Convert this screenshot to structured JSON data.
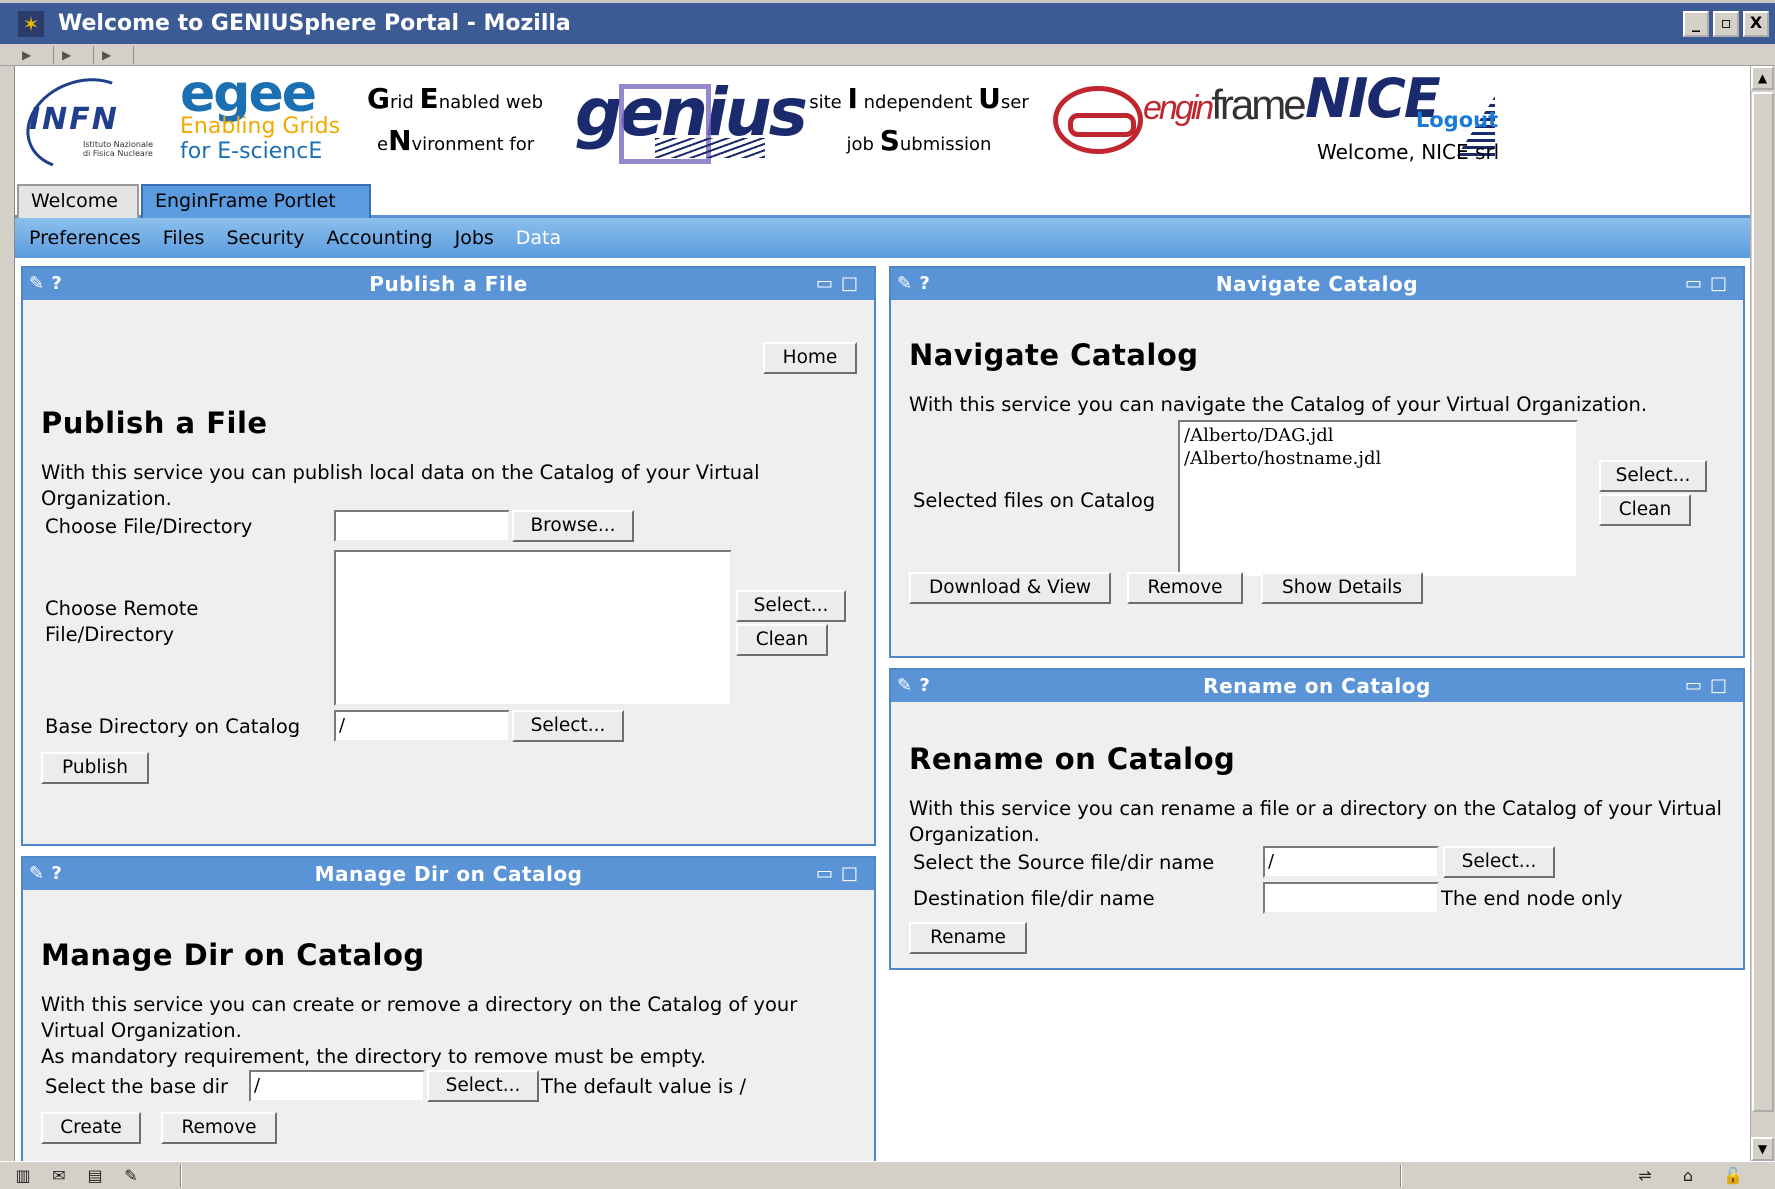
{
  "window": {
    "title": "Welcome to GENIUSphere Portal - Mozilla",
    "buttons": [
      "_",
      "▫",
      "X"
    ]
  },
  "header": {
    "infn_text": "INFN",
    "infn_small": "Istituto Nazionale di Fisica Nucleare",
    "egee_word": "egee",
    "egee_line1": "Enabling Grids",
    "egee_line2": "for E-sciencE",
    "genius_letters": [
      {
        "cap": "G",
        "rest": "rid "
      },
      {
        "cap": "E",
        "rest": "nabled web"
      },
      {
        "cap": "N",
        "rest": "vironment for"
      }
    ],
    "genius_line1_a": "G",
    "genius_line1_b": "rid",
    "genius_line1_c": "E",
    "genius_line1_d": "nabled web",
    "genius_line2_a": "e",
    "genius_line2_b": "N",
    "genius_line2_c": "vironment for",
    "genius_logo": "genius",
    "site_line1_a": "site ",
    "site_line1_b": "I",
    "site_line1_c": " ndependent ",
    "site_line1_d": "U",
    "site_line1_e": "ser",
    "site_line2_a": "job ",
    "site_line2_b": "S",
    "site_line2_c": "ubmission",
    "enginframe_a": "engin",
    "enginframe_b": "frame",
    "nice_logo": "NICE",
    "logout": "Logout",
    "welcome": "Welcome, NICE srl"
  },
  "tabs": [
    {
      "label": "Welcome",
      "active": false
    },
    {
      "label": "EnginFrame Portlet",
      "active": true
    }
  ],
  "menu": [
    "Preferences",
    "Files",
    "Security",
    "Accounting",
    "Jobs",
    "Data"
  ],
  "menu_current": "Data",
  "publish": {
    "header": "Publish a File",
    "home": "Home",
    "title": "Publish a File",
    "desc": "With this service you can publish local data on the Catalog of your Virtual Organization.",
    "choose_file_label": "Choose File/Directory",
    "choose_file_value": "",
    "browse": "Browse...",
    "choose_remote_label": "Choose Remote File/Directory",
    "select": "Select...",
    "clean": "Clean",
    "base_dir_label": "Base Directory on Catalog",
    "base_dir_value": "/",
    "base_select": "Select...",
    "publish": "Publish"
  },
  "manage": {
    "header": "Manage Dir on Catalog",
    "title": "Manage Dir on Catalog",
    "desc1": "With this service you can create or remove a directory on the Catalog of your Virtual Organization.",
    "desc2": "As mandatory requirement, the directory to remove must be empty.",
    "base_label": "Select the base dir",
    "base_value": "/",
    "select": "Select...",
    "default_note": "The default value is /",
    "create": "Create",
    "remove": "Remove"
  },
  "navigate": {
    "header": "Navigate Catalog",
    "title": "Navigate Catalog",
    "desc": "With this service you can navigate the Catalog of your Virtual Organization.",
    "selected_label": "Selected files on Catalog",
    "files": [
      "/Alberto/DAG.jdl",
      "/Alberto/hostname.jdl"
    ],
    "select": "Select...",
    "clean": "Clean",
    "download": "Download & View",
    "remove": "Remove",
    "details": "Show Details"
  },
  "rename": {
    "header": "Rename on Catalog",
    "title": "Rename on Catalog",
    "desc": "With this service you can rename a file or a directory on the Catalog of your Virtual Organization.",
    "source_label": "Select the Source file/dir name",
    "source_value": "/",
    "select": "Select...",
    "dest_label": "Destination file/dir name",
    "dest_value": "",
    "end_note": "The end node only",
    "rename": "Rename"
  }
}
